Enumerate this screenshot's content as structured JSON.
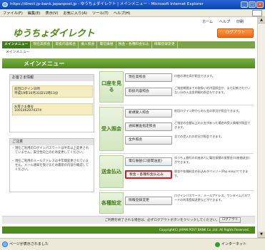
{
  "window": {
    "title": "https://direct.jp-bank.japanpost.jp - ゆうちょダイレクト | メインメニュー - Microsoft Internet Explorer",
    "minimize": "_",
    "maximize": "□",
    "close": "×"
  },
  "menubar": [
    "ファイル(F)",
    "編集(E)",
    "表示(V)",
    "お気に入り(A)",
    "ツール(T)",
    "ヘルプ(H)"
  ],
  "header": {
    "logo": "ゆうちょダイレクト",
    "links": [
      "ホーム",
      "ヘルプ",
      "印刷"
    ],
    "logout": "ログアウト"
  },
  "nav": [
    "メインメニュー",
    "現在高照会",
    "取扱内容照会",
    "振入照会",
    "電信振替",
    "税金・各種料金払込",
    "情報登録変更"
  ],
  "breadcrumb": "メインメニュー",
  "page_title": "メインメニュー",
  "messages": {
    "heading": "お客さま情報",
    "last_login_label": "前回ログイン日時",
    "last_login_value": "平成19年10月31日11時13分",
    "account_label": "お客さま番号",
    "account_value": "1001462074374"
  },
  "notes": {
    "heading": "ご注意",
    "items": [
      "現在ご利用のログインパスワードは半年以上変更されていません。安全性向上のため変更してください。",
      "現在ご利用のメールアドレスは半年間変更されていません。メール通知を受けるため最新の内容か確認してください。"
    ]
  },
  "sections": [
    {
      "label": "口座を見る",
      "buttons": [
        {
          "label": "現在高照会",
          "desc": "口座の現在高が照会できます。"
        },
        {
          "label": "取扱内容照会",
          "desc": "ご指定期間までの取扱いの内容照会が、また記帳されていない分の入出金明細の照会もできます。"
        }
      ]
    },
    {
      "label": "受入照会",
      "buttons": [
        {
          "label": "新規受入照会",
          "desc": "前回ログイン時からの入金の状況が照会できます。"
        },
        {
          "label": "通知審査指定照会",
          "desc": "ご指定の金額以上の入金があった場合の受入情報が照会できます。"
        },
        {
          "label": "全件照会",
          "desc": "全ての受入れの状況が照会できます。"
        }
      ]
    },
    {
      "label": "送金払込",
      "buttons": [
        {
          "label": "電信振替(口座間送金)",
          "desc": "ゆうちょ銀行の口座あてに電信振替の振替金(口座間送金)ができます。"
        },
        {
          "label": "税金・各種料金払込み",
          "desc": "税金や各種料金の払込みがペイジー(Pay-easy)でできます。"
        }
      ]
    },
    {
      "label": "各種設定",
      "buttons": [
        {
          "label": "情報登録変更",
          "desc": "ログインパスワード、メールアドレス、ワンタイムパスワードの利用登録変更などができます。"
        }
      ]
    }
  ],
  "footer": {
    "text": "ご利用を終了される場合は、必ずログアウトボタンをクリックしてください。",
    "logout": "ログアウト",
    "copyright": "Copyright(C) JAPAN POST BANK Co.,Ltd. All Rights Reserved."
  },
  "status": {
    "text": "ページが表示されました",
    "zone": "インターネット"
  },
  "colors": {
    "brand_green": "#4f8a20",
    "logout_orange": "#ef6b12",
    "highlight_red": "#e01a1a"
  }
}
